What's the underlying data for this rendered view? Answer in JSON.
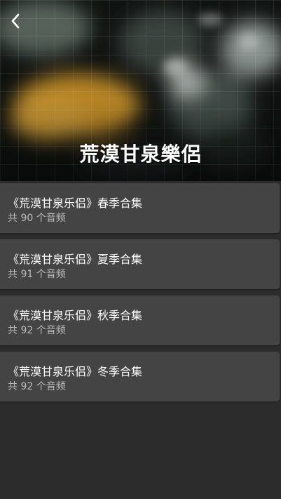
{
  "header": {
    "title": "荒漠甘泉樂侶",
    "back_icon": "chevron-left-icon"
  },
  "albums": [
    {
      "title": "《荒漠甘泉乐侣》春季合集",
      "count": "共 90 个音频"
    },
    {
      "title": "《荒漠甘泉乐侣》夏季合集",
      "count": "共 91 个音频"
    },
    {
      "title": "《荒漠甘泉乐侣》秋季合集",
      "count": "共 92 个音频"
    },
    {
      "title": "《荒漠甘泉乐侣》冬季合集",
      "count": "共 92 个音频"
    }
  ],
  "colors": {
    "background": "#2c2c2c",
    "card": "#444444",
    "subtitle": "#bdbdbd"
  }
}
